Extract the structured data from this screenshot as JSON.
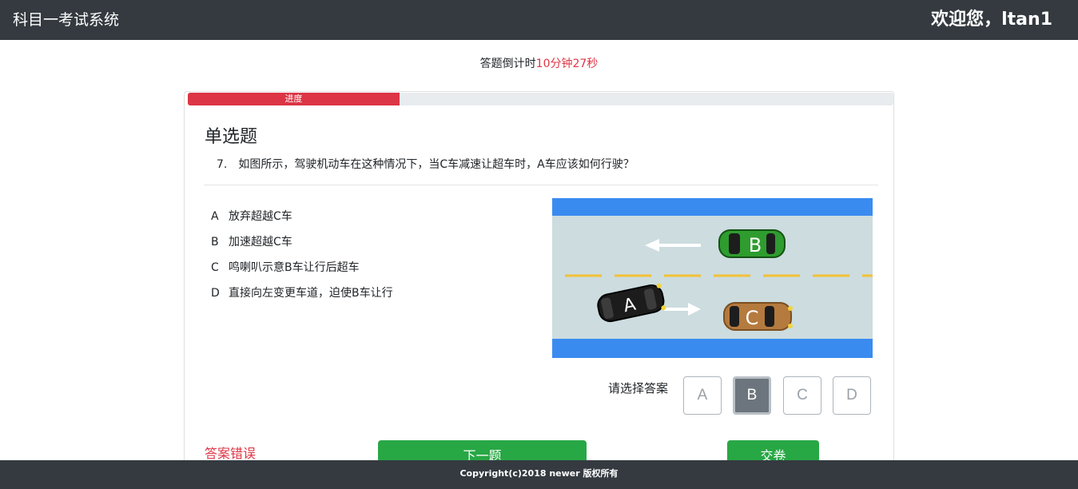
{
  "header": {
    "title": "科目一考试系统",
    "welcome": "欢迎您，ltan1"
  },
  "timer": {
    "label": "答题倒计时",
    "remaining": "10分钟27秒"
  },
  "progress": {
    "label": "进度",
    "fraction": 0.3
  },
  "question": {
    "type": "单选题",
    "number": "7.",
    "text": "如图所示，驾驶机动车在这种情况下，当C车减速让超车时，A车应该如何行驶？",
    "options": [
      {
        "letter": "A",
        "text": "放弃超越C车"
      },
      {
        "letter": "B",
        "text": "加速超越C车"
      },
      {
        "letter": "C",
        "text": "鸣喇叭示意B车让行后超车"
      },
      {
        "letter": "D",
        "text": "直接向左变更车道，迫使B车让行"
      }
    ],
    "image": {
      "car_labels": [
        "B",
        "A",
        "C"
      ],
      "road_color": "#ccdcdf",
      "edge_color": "#3a8bf0",
      "lane_color": "#f2c037"
    }
  },
  "answer": {
    "prompt": "请选择答案",
    "choices": [
      "A",
      "B",
      "C",
      "D"
    ],
    "selected": "B",
    "result": "答案错误"
  },
  "buttons": {
    "next": "下一题",
    "submit": "交卷"
  },
  "footer": {
    "copyright": "Copyright(c)2018 newer 版权所有"
  }
}
